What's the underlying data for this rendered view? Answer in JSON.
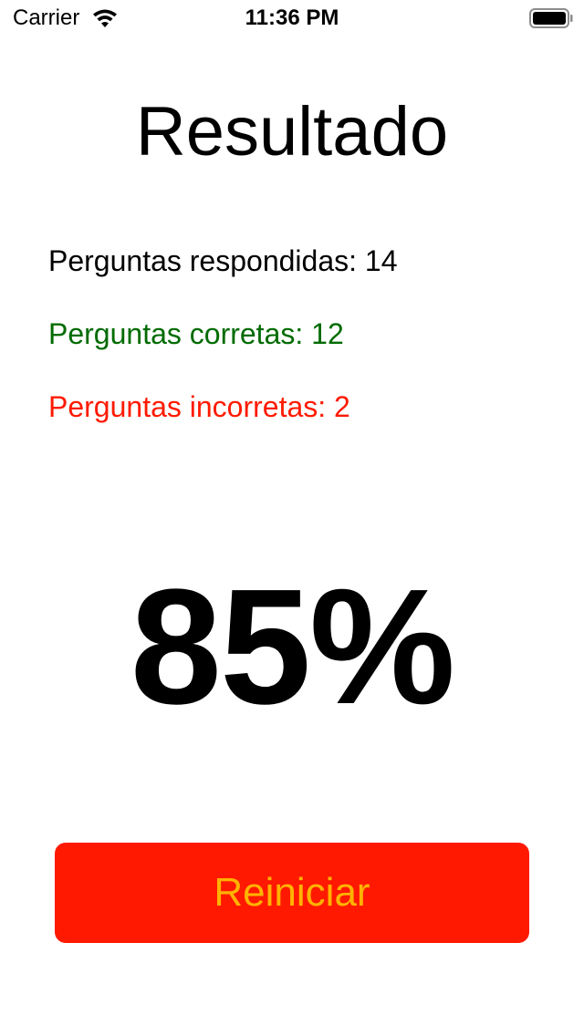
{
  "status_bar": {
    "carrier": "Carrier",
    "time": "11:36 PM",
    "wifi_icon": "wifi-icon",
    "battery_icon": "battery-icon",
    "battery_level": 1.0
  },
  "result": {
    "title": "Resultado",
    "answered": "Perguntas respondidas: 14",
    "correct": "Perguntas corretas: 12",
    "incorrect": "Perguntas incorretas: 2",
    "score": "85%"
  },
  "actions": {
    "restart_label": "Reiniciar"
  },
  "colors": {
    "correct": "#006b00",
    "incorrect": "#ff1a00",
    "button_background": "#ff1900",
    "button_text": "#ffb300"
  }
}
